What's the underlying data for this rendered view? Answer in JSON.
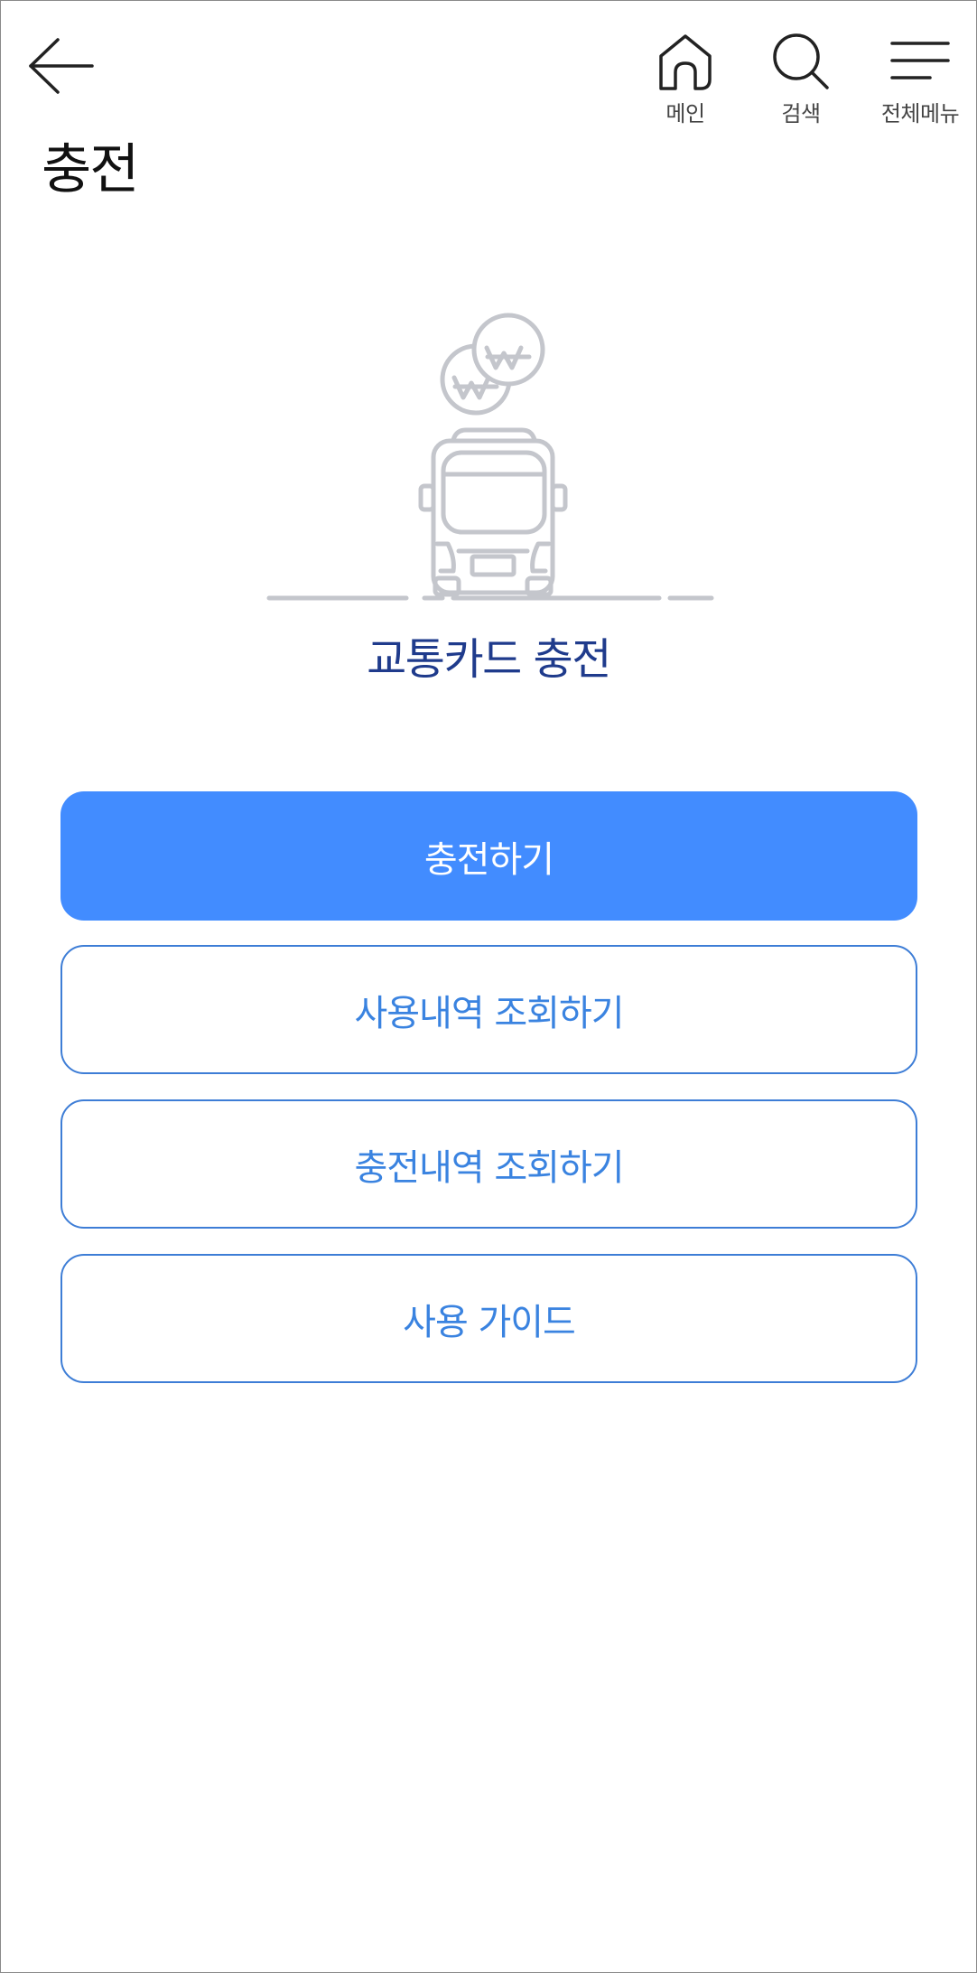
{
  "header": {
    "home_label": "메인",
    "search_label": "검색",
    "menu_label": "전체메뉴"
  },
  "page": {
    "title": "충전"
  },
  "main": {
    "section_title": "교통카드 충전",
    "buttons": {
      "charge": "충전하기",
      "usage_history": "사용내역 조회하기",
      "charge_history": "충전내역 조회하기",
      "guide": "사용 가이드"
    }
  },
  "colors": {
    "primary": "#428cff",
    "outline_text": "#3a83e0",
    "section_title": "#1f3b8c",
    "illustration": "#c4c6cc"
  },
  "icons": {
    "back": "back-arrow-icon",
    "home": "home-icon",
    "search": "search-icon",
    "menu": "hamburger-menu-icon",
    "illustration": "bus-with-coins-illustration"
  }
}
